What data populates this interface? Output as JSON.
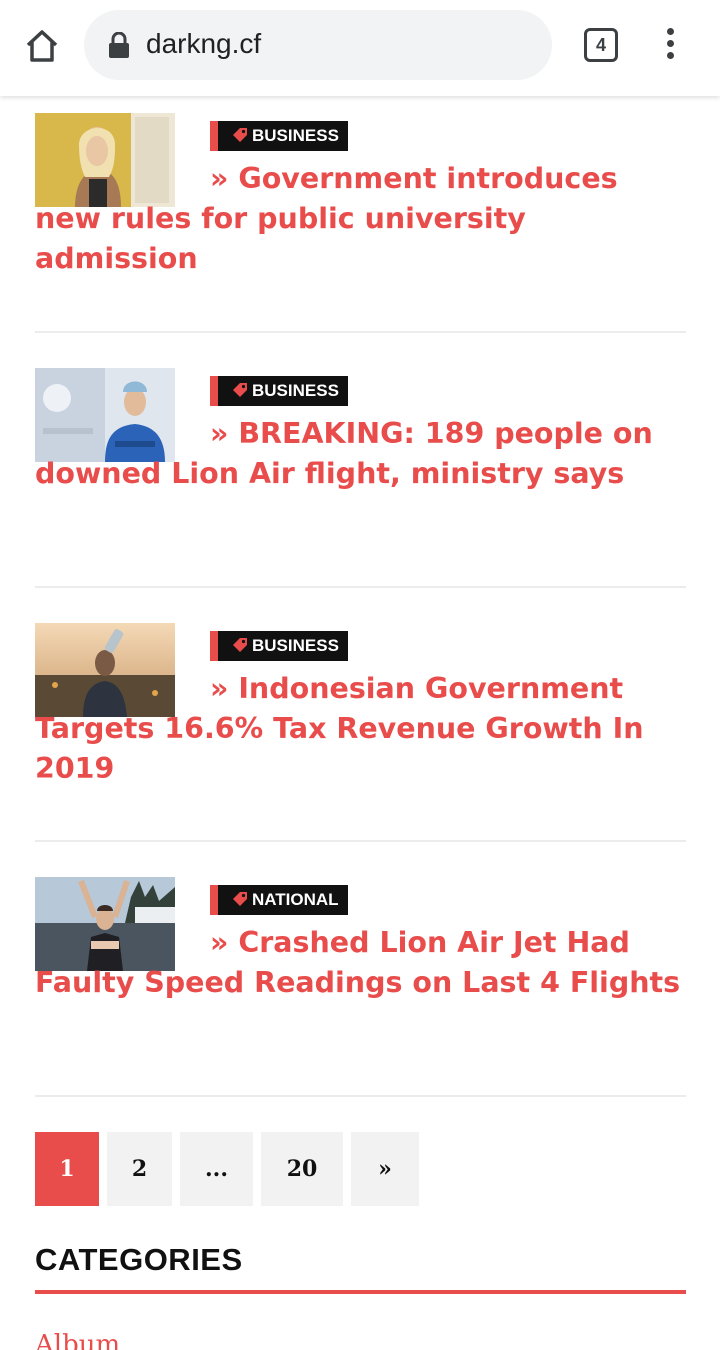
{
  "browser": {
    "url": "darkng.cf",
    "tab_count": "4"
  },
  "posts": [
    {
      "category": "BUSINESS",
      "title": "» Government introduces new rules for public university admission"
    },
    {
      "category": "BUSINESS",
      "title": "» BREAKING: 189 people on downed Lion Air flight, ministry says"
    },
    {
      "category": "BUSINESS",
      "title": "» Indonesian Government Targets 16.6% Tax Revenue Growth In 2019"
    },
    {
      "category": "NATIONAL",
      "title": "» Crashed Lion Air Jet Had Faulty Speed Readings on Last 4 Flights"
    }
  ],
  "pagination": {
    "pages": [
      "1",
      "2",
      "...",
      "20",
      "»"
    ],
    "current": "1"
  },
  "sidebar": {
    "categories_heading": "CATEGORIES",
    "first_category": "Album"
  },
  "colors": {
    "accent": "#e84d4c",
    "tag_bg": "#111111"
  }
}
